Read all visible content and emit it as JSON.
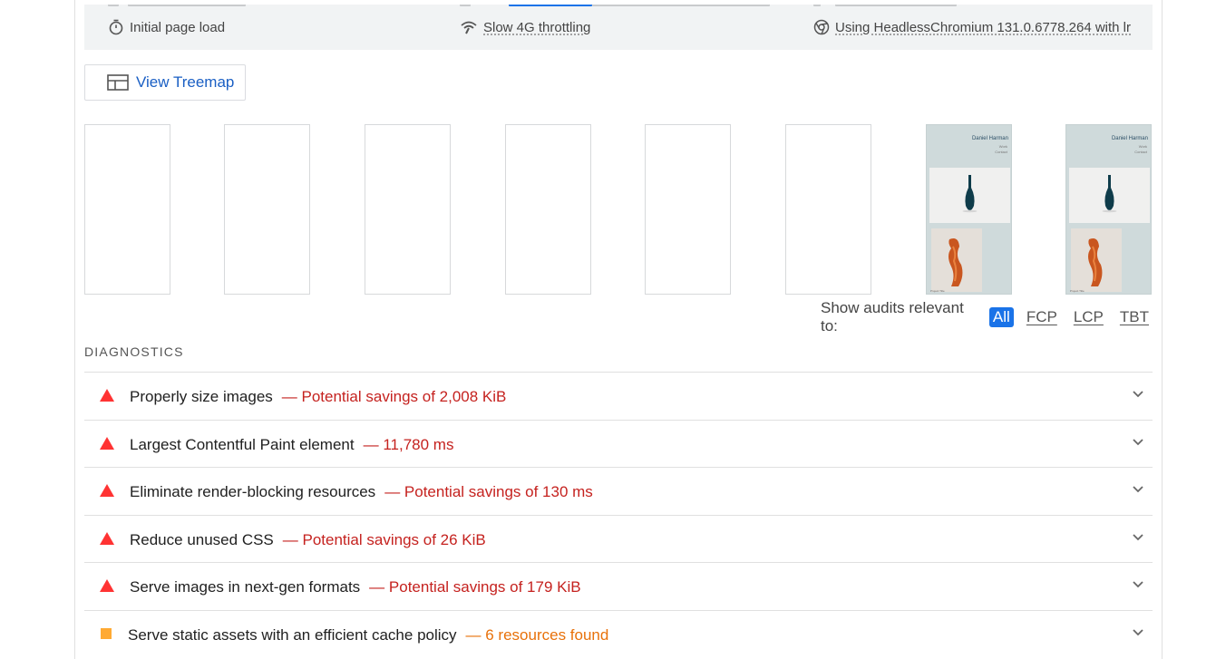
{
  "environment": {
    "items": [
      {
        "icon": "stopwatch-icon",
        "label": "Initial page load"
      },
      {
        "icon": "signal-icon",
        "label": "Slow 4G throttling"
      },
      {
        "icon": "chrome-icon",
        "label": "Using HeadlessChromium 131.0.6778.264 with lr"
      }
    ]
  },
  "treemap": {
    "label": "View Treemap",
    "icon": "treemap-icon"
  },
  "filmstrip": {
    "frame_count": 8,
    "painted_frames": [
      7,
      8
    ],
    "site_title": "Daniel Harman",
    "nav_1": "Work",
    "nav_2": "Contact",
    "caption": "Project Title"
  },
  "filter": {
    "label": "Show audits relevant to:",
    "options": [
      "All",
      "FCP",
      "LCP",
      "TBT"
    ],
    "selected": "All"
  },
  "diagnostics": {
    "heading": "DIAGNOSTICS",
    "audits": [
      {
        "severity": "fail",
        "title": "Properly size images",
        "detail": "— Potential savings of 2,008 KiB"
      },
      {
        "severity": "fail",
        "title": "Largest Contentful Paint element",
        "detail": "— 11,780 ms"
      },
      {
        "severity": "fail",
        "title": "Eliminate render-blocking resources",
        "detail": "— Potential savings of 130 ms"
      },
      {
        "severity": "fail",
        "title": "Reduce unused CSS",
        "detail": "— Potential savings of 26 KiB"
      },
      {
        "severity": "fail",
        "title": "Serve images in next-gen formats",
        "detail": "— Potential savings of 179 KiB"
      },
      {
        "severity": "average",
        "title": "Serve static assets with an efficient cache policy",
        "detail": "— 6 resources found"
      }
    ]
  },
  "colors": {
    "fail": "#f33",
    "average": "#fa3",
    "accent": "#1a73e8",
    "fail_text": "#c5221f",
    "average_text": "#e8710a"
  }
}
